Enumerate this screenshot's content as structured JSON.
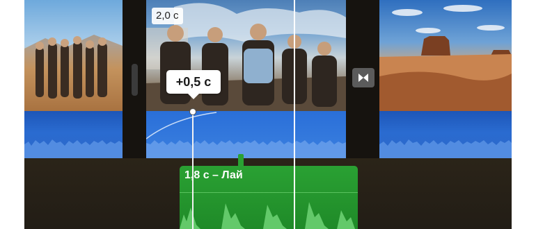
{
  "timeline": {
    "clip_duration": "2,0 с",
    "trim_offset": "+0,5 с",
    "background_clip_label": "1,8 с – Лай"
  },
  "colors": {
    "audio_blue": "#2a6bd0",
    "background_music_green": "#2aa133",
    "timeline_bg": "#1d1a16"
  },
  "icons": {
    "transition": "bowtie-transition-icon",
    "fade": "fade-curve-icon"
  }
}
